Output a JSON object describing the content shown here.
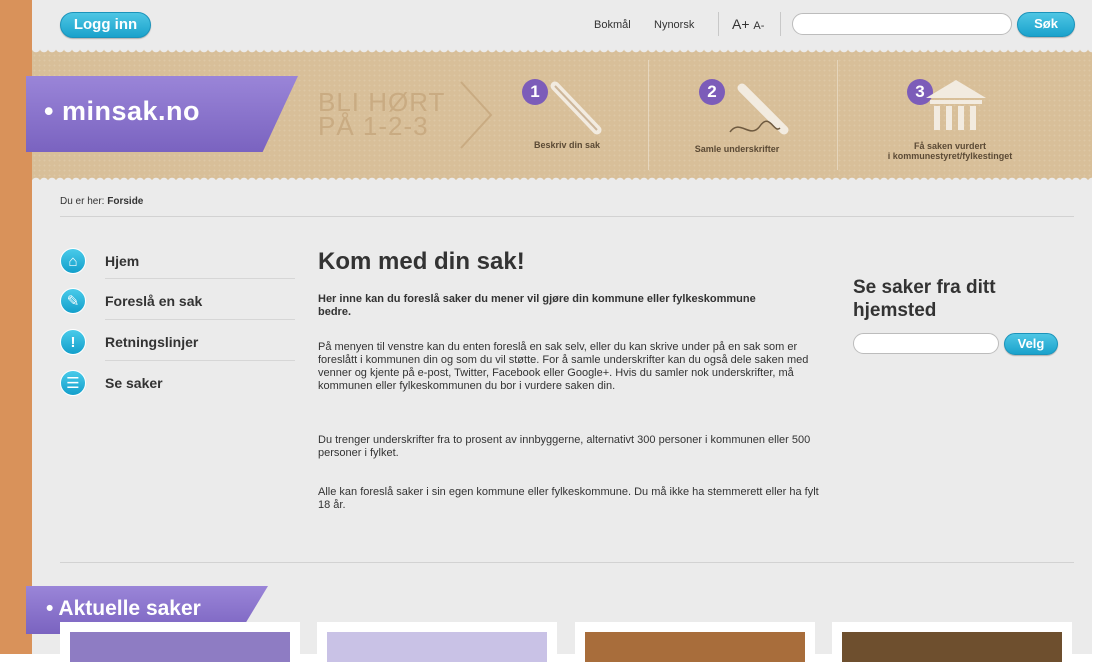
{
  "header": {
    "login_label": "Logg inn",
    "lang_bokmal": "Bokmål",
    "lang_nynorsk": "Nynorsk",
    "font_increase": "A+",
    "font_decrease": "A-",
    "search_placeholder": "",
    "search_button": "Søk"
  },
  "banner": {
    "logo_text": "minsak.no",
    "tagline_line1": "BLI HØRT",
    "tagline_line2": "PÅ 1-2-3",
    "steps": [
      {
        "number": "1",
        "label_line1": "Beskriv din sak",
        "label_line2": ""
      },
      {
        "number": "2",
        "label_line1": "Samle underskrifter",
        "label_line2": ""
      },
      {
        "number": "3",
        "label_line1": "Få saken vurdert",
        "label_line2": "i kommunestyret/fylkestinget"
      }
    ]
  },
  "breadcrumb": {
    "prefix": "Du er her:",
    "current": "Forside"
  },
  "nav": {
    "items": [
      {
        "label": "Hjem",
        "icon": "home-icon"
      },
      {
        "label": "Foreslå en sak",
        "icon": "pen-icon"
      },
      {
        "label": "Retningslinjer",
        "icon": "exclamation-icon"
      },
      {
        "label": "Se saker",
        "icon": "list-icon"
      }
    ]
  },
  "main": {
    "title": "Kom med din sak!",
    "intro": "Her inne kan du foreslå saker du mener vil gjøre din kommune eller fylkeskommune bedre.",
    "paragraphs": [
      "På menyen til venstre kan du enten foreslå en sak selv, eller du kan skrive under på en sak som er foreslått i kommunen din og som du vil støtte. For å samle underskrifter kan du også dele saken med venner og kjente på e-post, Twitter, Facebook eller Google+. Hvis du samler nok underskrifter, må kommunen eller fylkeskommunen du bor i vurdere saken din.",
      "Du trenger underskrifter fra to prosent av innbyggerne, alternativt 300 personer i kommunen eller 500 personer i fylket.",
      "Alle kan foreslå saker i sin egen kommune eller fylkeskommune. Du må ikke ha stemmerett eller ha fylt 18 år."
    ]
  },
  "right": {
    "title": "Se saker fra ditt hjemsted",
    "input_placeholder": "",
    "button_label": "Velg"
  },
  "bottom": {
    "section_title": "Aktuelle saker",
    "card_colors": [
      "#8e7cc3",
      "#c9c2e6",
      "#a86d3b",
      "#6e4f2e"
    ]
  },
  "colors": {
    "accent_blue": "#1aa2cc",
    "accent_purple": "#7c5cb9",
    "banner_tan": "#d8bf99",
    "page_bg": "#ebebeb"
  }
}
